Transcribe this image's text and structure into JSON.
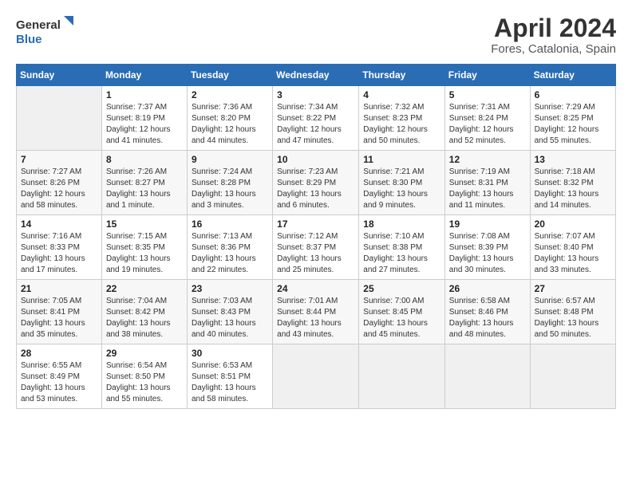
{
  "header": {
    "logo_line1": "General",
    "logo_line2": "Blue",
    "month": "April 2024",
    "location": "Fores, Catalonia, Spain"
  },
  "weekdays": [
    "Sunday",
    "Monday",
    "Tuesday",
    "Wednesday",
    "Thursday",
    "Friday",
    "Saturday"
  ],
  "weeks": [
    [
      {
        "day": "",
        "info": ""
      },
      {
        "day": "1",
        "info": "Sunrise: 7:37 AM\nSunset: 8:19 PM\nDaylight: 12 hours\nand 41 minutes."
      },
      {
        "day": "2",
        "info": "Sunrise: 7:36 AM\nSunset: 8:20 PM\nDaylight: 12 hours\nand 44 minutes."
      },
      {
        "day": "3",
        "info": "Sunrise: 7:34 AM\nSunset: 8:22 PM\nDaylight: 12 hours\nand 47 minutes."
      },
      {
        "day": "4",
        "info": "Sunrise: 7:32 AM\nSunset: 8:23 PM\nDaylight: 12 hours\nand 50 minutes."
      },
      {
        "day": "5",
        "info": "Sunrise: 7:31 AM\nSunset: 8:24 PM\nDaylight: 12 hours\nand 52 minutes."
      },
      {
        "day": "6",
        "info": "Sunrise: 7:29 AM\nSunset: 8:25 PM\nDaylight: 12 hours\nand 55 minutes."
      }
    ],
    [
      {
        "day": "7",
        "info": "Sunrise: 7:27 AM\nSunset: 8:26 PM\nDaylight: 12 hours\nand 58 minutes."
      },
      {
        "day": "8",
        "info": "Sunrise: 7:26 AM\nSunset: 8:27 PM\nDaylight: 13 hours\nand 1 minute."
      },
      {
        "day": "9",
        "info": "Sunrise: 7:24 AM\nSunset: 8:28 PM\nDaylight: 13 hours\nand 3 minutes."
      },
      {
        "day": "10",
        "info": "Sunrise: 7:23 AM\nSunset: 8:29 PM\nDaylight: 13 hours\nand 6 minutes."
      },
      {
        "day": "11",
        "info": "Sunrise: 7:21 AM\nSunset: 8:30 PM\nDaylight: 13 hours\nand 9 minutes."
      },
      {
        "day": "12",
        "info": "Sunrise: 7:19 AM\nSunset: 8:31 PM\nDaylight: 13 hours\nand 11 minutes."
      },
      {
        "day": "13",
        "info": "Sunrise: 7:18 AM\nSunset: 8:32 PM\nDaylight: 13 hours\nand 14 minutes."
      }
    ],
    [
      {
        "day": "14",
        "info": "Sunrise: 7:16 AM\nSunset: 8:33 PM\nDaylight: 13 hours\nand 17 minutes."
      },
      {
        "day": "15",
        "info": "Sunrise: 7:15 AM\nSunset: 8:35 PM\nDaylight: 13 hours\nand 19 minutes."
      },
      {
        "day": "16",
        "info": "Sunrise: 7:13 AM\nSunset: 8:36 PM\nDaylight: 13 hours\nand 22 minutes."
      },
      {
        "day": "17",
        "info": "Sunrise: 7:12 AM\nSunset: 8:37 PM\nDaylight: 13 hours\nand 25 minutes."
      },
      {
        "day": "18",
        "info": "Sunrise: 7:10 AM\nSunset: 8:38 PM\nDaylight: 13 hours\nand 27 minutes."
      },
      {
        "day": "19",
        "info": "Sunrise: 7:08 AM\nSunset: 8:39 PM\nDaylight: 13 hours\nand 30 minutes."
      },
      {
        "day": "20",
        "info": "Sunrise: 7:07 AM\nSunset: 8:40 PM\nDaylight: 13 hours\nand 33 minutes."
      }
    ],
    [
      {
        "day": "21",
        "info": "Sunrise: 7:05 AM\nSunset: 8:41 PM\nDaylight: 13 hours\nand 35 minutes."
      },
      {
        "day": "22",
        "info": "Sunrise: 7:04 AM\nSunset: 8:42 PM\nDaylight: 13 hours\nand 38 minutes."
      },
      {
        "day": "23",
        "info": "Sunrise: 7:03 AM\nSunset: 8:43 PM\nDaylight: 13 hours\nand 40 minutes."
      },
      {
        "day": "24",
        "info": "Sunrise: 7:01 AM\nSunset: 8:44 PM\nDaylight: 13 hours\nand 43 minutes."
      },
      {
        "day": "25",
        "info": "Sunrise: 7:00 AM\nSunset: 8:45 PM\nDaylight: 13 hours\nand 45 minutes."
      },
      {
        "day": "26",
        "info": "Sunrise: 6:58 AM\nSunset: 8:46 PM\nDaylight: 13 hours\nand 48 minutes."
      },
      {
        "day": "27",
        "info": "Sunrise: 6:57 AM\nSunset: 8:48 PM\nDaylight: 13 hours\nand 50 minutes."
      }
    ],
    [
      {
        "day": "28",
        "info": "Sunrise: 6:55 AM\nSunset: 8:49 PM\nDaylight: 13 hours\nand 53 minutes."
      },
      {
        "day": "29",
        "info": "Sunrise: 6:54 AM\nSunset: 8:50 PM\nDaylight: 13 hours\nand 55 minutes."
      },
      {
        "day": "30",
        "info": "Sunrise: 6:53 AM\nSunset: 8:51 PM\nDaylight: 13 hours\nand 58 minutes."
      },
      {
        "day": "",
        "info": ""
      },
      {
        "day": "",
        "info": ""
      },
      {
        "day": "",
        "info": ""
      },
      {
        "day": "",
        "info": ""
      }
    ]
  ]
}
